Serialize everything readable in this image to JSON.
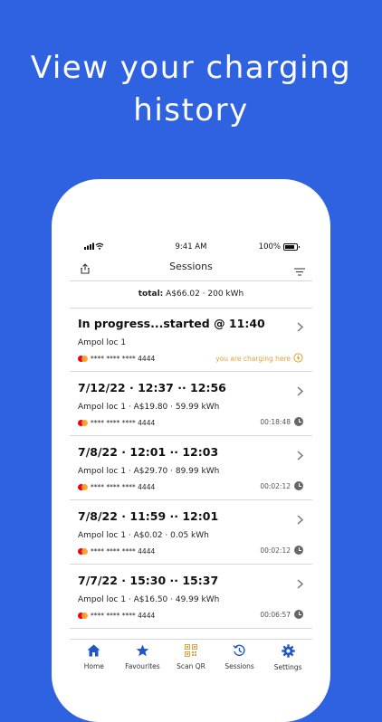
{
  "headline": {
    "line1": "View your charging",
    "line2": "history"
  },
  "status_bar": {
    "time": "9:41 AM",
    "battery": "100%"
  },
  "nav": {
    "title": "Sessions"
  },
  "total": {
    "label": "total:",
    "value": "A$66.02 · 200 kWh"
  },
  "sessions": [
    {
      "title": "In progress...started @ 11:40",
      "location": "Ampol loc 1",
      "card": "**** **** **** 4444",
      "status": "you are charging here",
      "in_progress": true
    },
    {
      "title": "7/12/22 · 12:37 ·· 12:56",
      "location": "Ampol loc 1 · A$19.80 · 59.99 kWh",
      "card": "**** **** **** 4444",
      "duration": "00:18:48"
    },
    {
      "title": "7/8/22 · 12:01 ·· 12:03",
      "location": "Ampol loc 1 · A$29.70 · 89.99 kWh",
      "card": "**** **** **** 4444",
      "duration": "00:02:12"
    },
    {
      "title": "7/8/22 · 11:59 ·· 12:01",
      "location": "Ampol loc 1 · A$0.02 · 0.05 kWh",
      "card": "**** **** **** 4444",
      "duration": "00:02:12"
    },
    {
      "title": "7/7/22 · 15:30 ·· 15:37",
      "location": "Ampol loc 1 · A$16.50 · 49.99 kWh",
      "card": "**** **** **** 4444",
      "duration": "00:06:57"
    }
  ],
  "tabs": [
    {
      "label": "Home",
      "icon": "home-icon",
      "color": "#1f56c8"
    },
    {
      "label": "Favourites",
      "icon": "star-icon",
      "color": "#1f56c8"
    },
    {
      "label": "Scan QR",
      "icon": "qr-code-icon",
      "color": "#e0a23a"
    },
    {
      "label": "Sessions",
      "icon": "history-icon",
      "color": "#1f56c8"
    },
    {
      "label": "Settings",
      "icon": "gear-icon",
      "color": "#1f56c8"
    }
  ],
  "colors": {
    "background": "#2f62e0",
    "accent": "#1f56c8",
    "charging": "#e0a23a"
  }
}
